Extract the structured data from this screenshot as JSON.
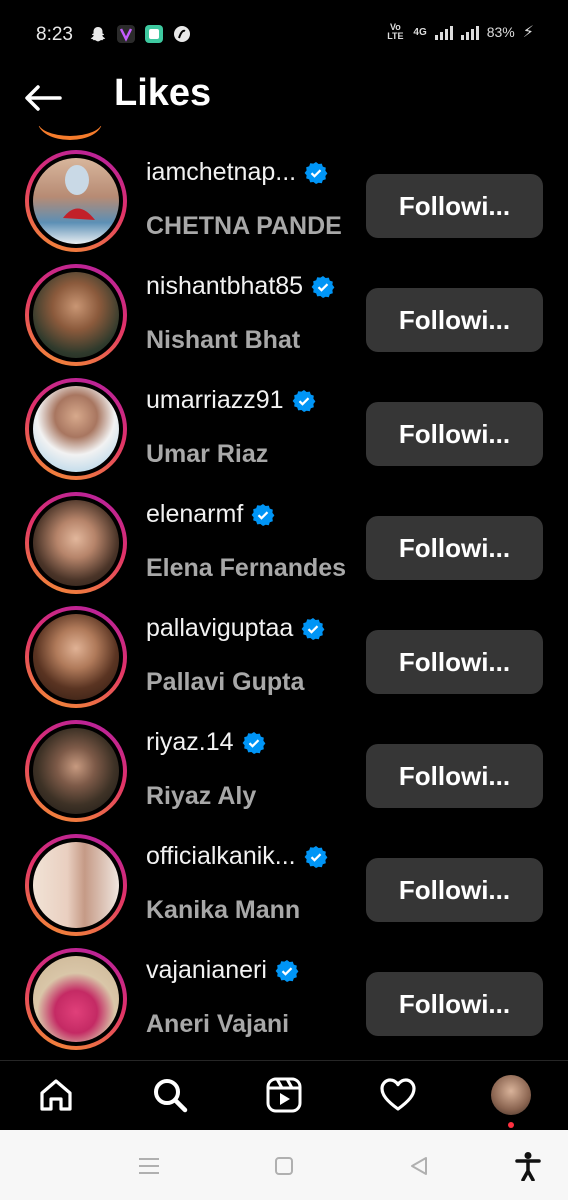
{
  "status_bar": {
    "time": "8:23",
    "volte": "Vo\nLTE",
    "network": "4G",
    "battery": "83%"
  },
  "header": {
    "title": "Likes"
  },
  "colors": {
    "background": "#000000",
    "button_bg": "#363636",
    "verified_blue": "#0095f6",
    "secondary_text": "#a8a8a8",
    "ring_gradient": [
      "#b01fa6",
      "#e0306a",
      "#f59331"
    ]
  },
  "users": [
    {
      "username": "iamchetnap...",
      "full_name": "CHETNA PANDE",
      "verified": true,
      "button": "Followi..."
    },
    {
      "username": "nishantbhat85",
      "full_name": "Nishant Bhat",
      "verified": true,
      "button": "Followi..."
    },
    {
      "username": "umarriazz91",
      "full_name": "Umar Riaz",
      "verified": true,
      "button": "Followi..."
    },
    {
      "username": "elenarmf",
      "full_name": "Elena Fernandes",
      "verified": true,
      "button": "Followi..."
    },
    {
      "username": "pallaviguptaa",
      "full_name": "Pallavi Gupta",
      "verified": true,
      "button": "Followi..."
    },
    {
      "username": "riyaz.14",
      "full_name": "Riyaz Aly",
      "verified": true,
      "button": "Followi..."
    },
    {
      "username": "officialkanik...",
      "full_name": "Kanika Mann",
      "verified": true,
      "button": "Followi..."
    },
    {
      "username": "vajanianeri",
      "full_name": "Aneri Vajani",
      "verified": true,
      "button": "Followi..."
    }
  ],
  "bottom_nav": {
    "items": [
      "home-icon",
      "search-icon",
      "reels-icon",
      "heart-icon",
      "profile-avatar"
    ]
  },
  "system_nav": {
    "items": [
      "menu-icon",
      "home-square-icon",
      "back-triangle-icon",
      "accessibility-icon"
    ]
  }
}
